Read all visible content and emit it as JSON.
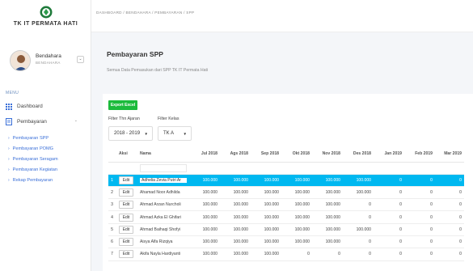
{
  "app": {
    "title": "TK IT PERMATA HATI"
  },
  "user": {
    "name": "Bendahara",
    "role": "BENDAHARA",
    "toggle": "⌄"
  },
  "sidebar": {
    "menu_label": "MENU",
    "items": [
      {
        "label": "Dashboard",
        "icon": "grid-icon"
      },
      {
        "label": "Pembayaran",
        "icon": "receipt-icon"
      }
    ],
    "sub_items": [
      {
        "label": "Pembayaran SPP"
      },
      {
        "label": "Pembayaran POMG"
      },
      {
        "label": "Pembayaran Seragam"
      },
      {
        "label": "Pembayaran Kegiatan"
      },
      {
        "label": "Rekap Pembayaran"
      }
    ]
  },
  "breadcrumb": "DASHBOARD  /  BENDAHARA  /  PEMBAYARAN  /  SPP",
  "page": {
    "title": "Pembayaran SPP",
    "subtitle": "Semua Data Pemasukan dari SPP TK IT Permata Hati"
  },
  "toolbar": {
    "export_label": "Export Excel",
    "filter_year_label": "Filter Thn Ajaran",
    "filter_year_value": "2018 - 2019",
    "filter_class_label": "Filter Kelas",
    "filter_class_value": "TK A"
  },
  "table": {
    "headers": [
      "Aksi",
      "Nama",
      "Jul 2018",
      "Ags 2018",
      "Sep 2018",
      "Okt 2018",
      "Nov 2018",
      "Des 2018",
      "Jan 2019",
      "Feb 2019",
      "Mar 2019"
    ],
    "edit_label": "Edit",
    "rows": [
      {
        "no": "1",
        "name": "Adhelia Zevia Putri Ar",
        "values": [
          "100.000",
          "100.000",
          "100.000",
          "100.000",
          "100.000",
          "100.000",
          "0",
          "0",
          "0"
        ]
      },
      {
        "no": "2",
        "name": "Ahamad Noor Adhilda",
        "values": [
          "100.000",
          "100.000",
          "100.000",
          "100.000",
          "100.000",
          "100.000",
          "0",
          "0",
          "0"
        ]
      },
      {
        "no": "3",
        "name": "Ahmad Arzan Nurcholi",
        "values": [
          "100.000",
          "100.000",
          "100.000",
          "100.000",
          "100.000",
          "0",
          "0",
          "0",
          "0"
        ]
      },
      {
        "no": "4",
        "name": "Ahmad Azka El Ghifari",
        "values": [
          "100.000",
          "100.000",
          "100.000",
          "100.000",
          "100.000",
          "0",
          "0",
          "0",
          "0"
        ]
      },
      {
        "no": "5",
        "name": "Ahmad Baihaqi Shofyi",
        "values": [
          "100.000",
          "100.000",
          "100.000",
          "100.000",
          "100.000",
          "100.000",
          "0",
          "0",
          "0"
        ]
      },
      {
        "no": "6",
        "name": "Aisya Alfa Rizqiya",
        "values": [
          "100.000",
          "100.000",
          "100.000",
          "100.000",
          "100.000",
          "0",
          "0",
          "0",
          "0"
        ]
      },
      {
        "no": "7",
        "name": "Akifa Nayla Hardiyanti",
        "values": [
          "100.000",
          "100.000",
          "100.000",
          "0",
          "0",
          "0",
          "0",
          "0",
          "0"
        ]
      }
    ]
  },
  "colors": {
    "accent_green": "#1cbb3c",
    "selected_row": "#00b8f0",
    "link_blue": "#3a6fd8"
  }
}
